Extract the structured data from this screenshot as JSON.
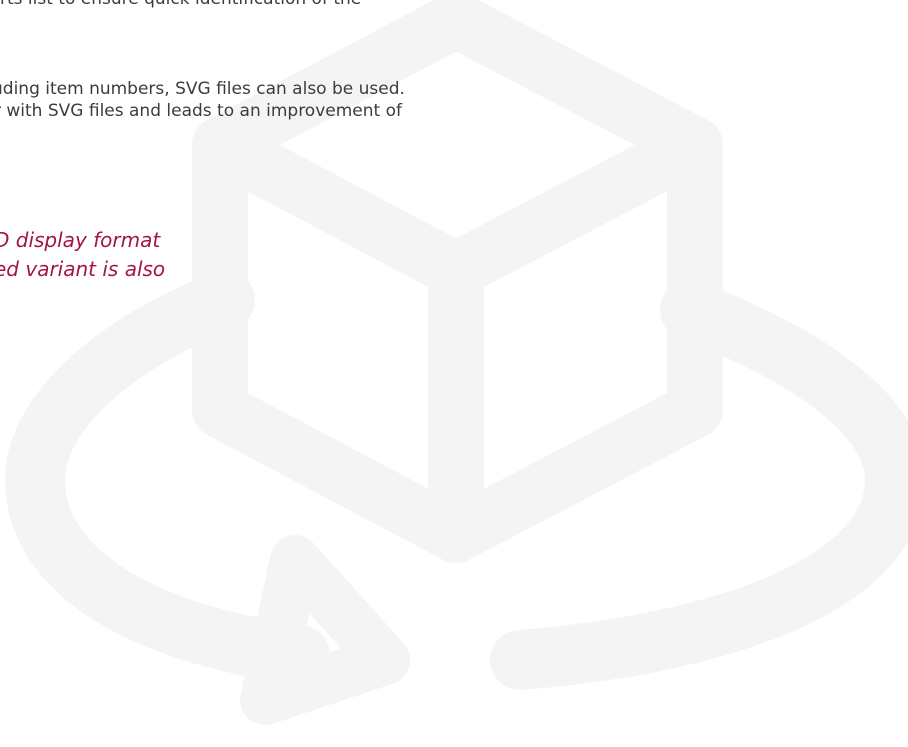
{
  "paragraphs": [
    {
      "lines": [
        "rts list to ensure quick identification of the"
      ]
    },
    {
      "lines": [
        "uding item numbers, SVG files can also be used.",
        "r with SVG files and leads to an improvement of"
      ]
    }
  ],
  "quote": {
    "lines": [
      "D display format",
      "ed variant is also"
    ]
  },
  "background_icon": "3d-rotate-icon",
  "colors": {
    "body_text": "#3c3c3c",
    "quote_text": "#a3163f",
    "watermark": "#f4f4f4"
  }
}
